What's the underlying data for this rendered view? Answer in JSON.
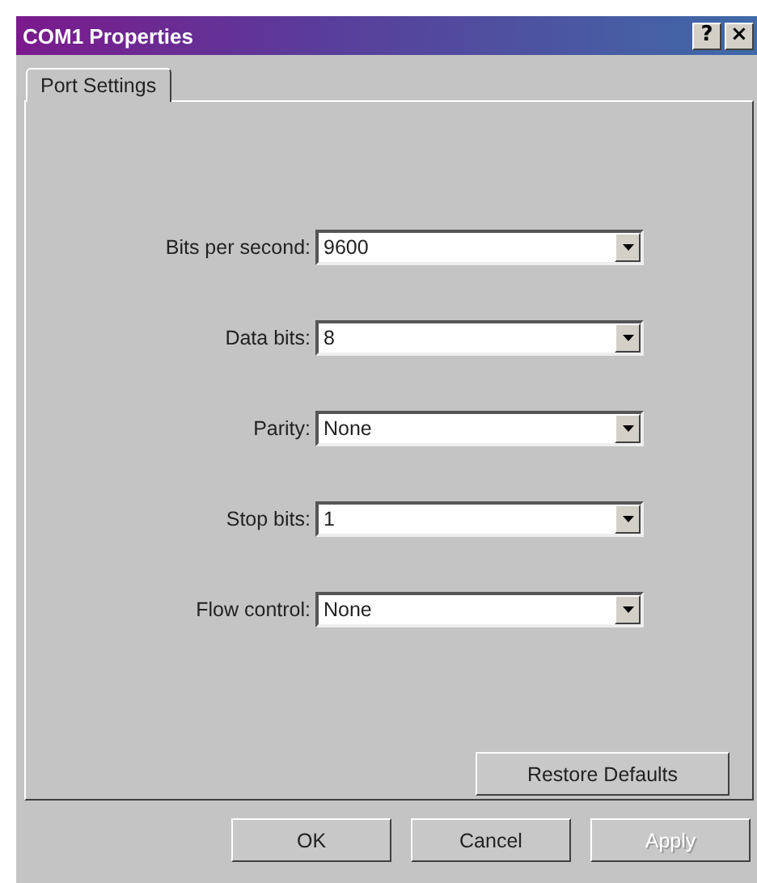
{
  "window": {
    "title": "COM1 Properties",
    "title_buttons": [
      "?",
      "×"
    ]
  },
  "tabs": [
    {
      "label": "Port Settings",
      "selected": true
    }
  ],
  "fields": [
    {
      "label": "Bits per second:",
      "value": "9600"
    },
    {
      "label": "Data bits:",
      "value": "8"
    },
    {
      "label": "Parity:",
      "value": "None"
    },
    {
      "label": "Stop bits:",
      "value": "1"
    },
    {
      "label": "Flow control:",
      "value": "None"
    }
  ],
  "restore_button": "Restore Defaults",
  "buttons": [
    {
      "label": "OK",
      "disabled": false
    },
    {
      "label": "Cancel",
      "disabled": false
    },
    {
      "label": "Apply",
      "disabled": true
    }
  ]
}
